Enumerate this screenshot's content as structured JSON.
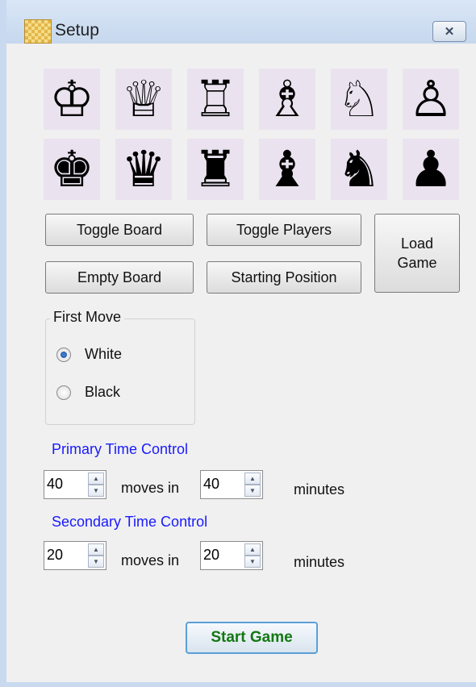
{
  "window": {
    "title": "Setup",
    "close_glyph": "✕",
    "icon": "chessboard-icon"
  },
  "pieces": {
    "white": [
      {
        "name": "white-king",
        "glyph": "♔"
      },
      {
        "name": "white-queen",
        "glyph": "♕"
      },
      {
        "name": "white-rook",
        "glyph": "♖"
      },
      {
        "name": "white-bishop",
        "glyph": "♗"
      },
      {
        "name": "white-knight",
        "glyph": "♘"
      },
      {
        "name": "white-pawn",
        "glyph": "♙"
      }
    ],
    "black": [
      {
        "name": "black-king",
        "glyph": "♚"
      },
      {
        "name": "black-queen",
        "glyph": "♛"
      },
      {
        "name": "black-rook",
        "glyph": "♜"
      },
      {
        "name": "black-bishop",
        "glyph": "♝"
      },
      {
        "name": "black-knight",
        "glyph": "♞"
      },
      {
        "name": "black-pawn",
        "glyph": "♟"
      }
    ]
  },
  "buttons": {
    "toggle_board": "Toggle Board",
    "toggle_players": "Toggle Players",
    "load_game": "Load Game",
    "empty_board": "Empty Board",
    "starting_position": "Starting Position",
    "start_game": "Start Game"
  },
  "first_move": {
    "title": "First Move",
    "options": [
      "White",
      "Black"
    ],
    "selected": "White"
  },
  "primary_time": {
    "label": "Primary Time Control",
    "moves": "40",
    "moves_in": "moves in",
    "minutes": "40",
    "minutes_label": "minutes"
  },
  "secondary_time": {
    "label": "Secondary Time Control",
    "moves": "20",
    "moves_in": "moves in",
    "minutes": "20",
    "minutes_label": "minutes"
  },
  "colors": {
    "accent_blue": "#1a1aff",
    "start_green": "#127812",
    "piece_bg": "#eae3ef"
  }
}
